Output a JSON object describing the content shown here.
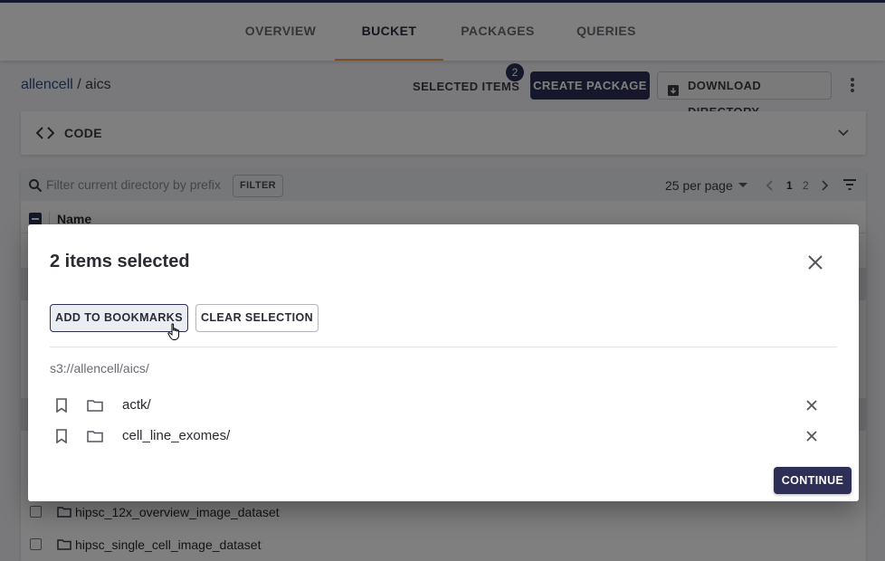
{
  "tabs": [
    {
      "label": "OVERVIEW",
      "active": false
    },
    {
      "label": "BUCKET",
      "active": true
    },
    {
      "label": "PACKAGES",
      "active": false
    },
    {
      "label": "QUERIES",
      "active": false
    }
  ],
  "breadcrumb": {
    "root": "allencell",
    "separator": "/",
    "current": "aics"
  },
  "toolbar": {
    "selected_items_label": "SELECTED ITEMS",
    "selected_count": "2",
    "create_package_label": "CREATE PACKAGE",
    "download_directory_label": "DOWNLOAD DIRECTORY"
  },
  "code_panel": {
    "label": "CODE"
  },
  "listing": {
    "filter_placeholder": "Filter current directory by prefix",
    "filter_button": "FILTER",
    "per_page": "25 per page",
    "pages": [
      "1",
      "2"
    ],
    "column_name": "Name",
    "visible_rows": [
      "hipsc_12x_overview_image_dataset",
      "hipsc_single_cell_image_dataset"
    ]
  },
  "dialog": {
    "title": "2 items selected",
    "add_bookmarks_label": "ADD TO BOOKMARKS",
    "clear_selection_label": "CLEAR SELECTION",
    "path": "s3://allencell/aics/",
    "items": [
      {
        "name": "actk/"
      },
      {
        "name": "cell_line_exomes/"
      }
    ],
    "continue_label": "CONTINUE"
  },
  "colors": {
    "primary": "#2d2f57",
    "tab_underline": "#f5a34e",
    "link": "#2a4f8f"
  }
}
